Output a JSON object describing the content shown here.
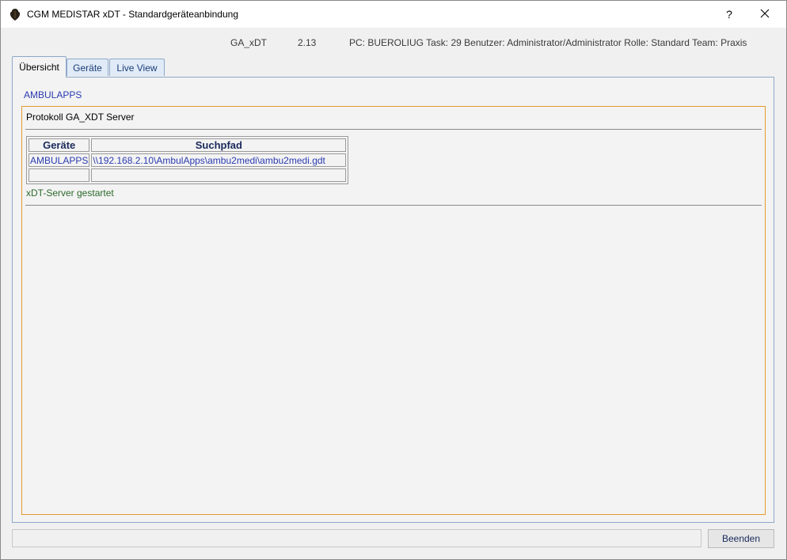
{
  "window": {
    "title": "CGM MEDISTAR xDT - Standardgeräteanbindung",
    "help_label": "?",
    "close_label": "✕"
  },
  "info": {
    "module": "GA_xDT",
    "version": "2.13",
    "details": "PC: BUEROLIUG Task: 29 Benutzer: Administrator/Administrator Rolle: Standard Team: Praxis"
  },
  "tabs": [
    {
      "label": "Übersicht",
      "active": true
    },
    {
      "label": "Geräte",
      "active": false
    },
    {
      "label": "Live View",
      "active": false
    }
  ],
  "overview": {
    "heading": "AMBULAPPS",
    "protocol_title": "Protokoll GA_XDT Server",
    "table": {
      "headers": [
        "Geräte",
        "Suchpfad"
      ],
      "rows": [
        [
          "AMBULAPPS",
          "\\\\192.168.2.10\\AmbulApps\\ambu2medi\\ambu2medi.gdt"
        ],
        [
          "",
          ""
        ]
      ]
    },
    "status": "xDT-Server gestartet"
  },
  "footer": {
    "status_value": "",
    "exit_label": "Beenden"
  },
  "colors": {
    "accent_border": "#e59a2e",
    "link_blue": "#2a3bb0",
    "status_green": "#2b6a2b"
  }
}
